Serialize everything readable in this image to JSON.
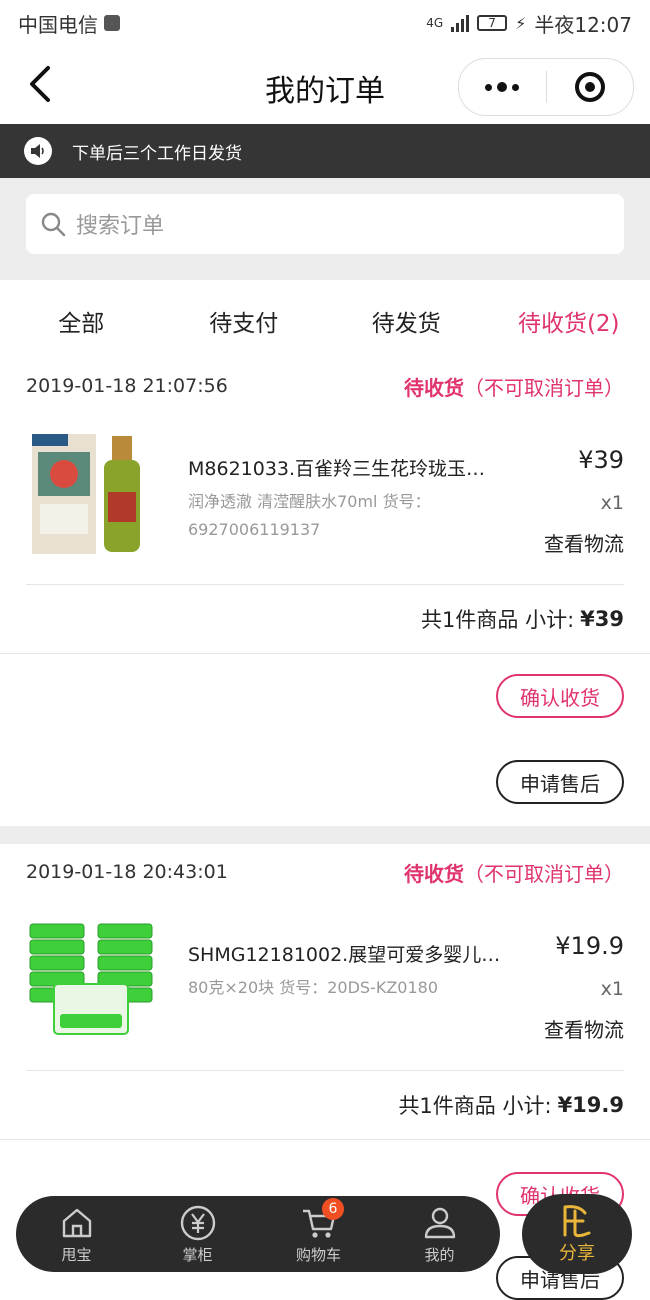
{
  "status_bar": {
    "carrier": "中国电信",
    "network": "4G",
    "battery": "7",
    "time": "半夜12:07"
  },
  "header": {
    "title": "我的订单"
  },
  "notice": {
    "text": "下单后三个工作日发货"
  },
  "search": {
    "placeholder": "搜索订单"
  },
  "tabs": [
    {
      "label": "全部",
      "active": false
    },
    {
      "label": "待支付",
      "active": false
    },
    {
      "label": "待发货",
      "active": false
    },
    {
      "label": "待收货(2)",
      "active": true
    }
  ],
  "orders": [
    {
      "time": "2019-01-18 21:07:56",
      "status": "待收货",
      "status_note": "（不可取消订单）",
      "item_title": "M8621033.百雀羚三生花玲珑玉…",
      "item_spec": "润净透澈   清滢醒肤水70ml   货号：6927006119137",
      "price": "¥39",
      "qty": "x1",
      "logistics": "查看物流",
      "subtotal_label": "共1件商品 小计:",
      "subtotal_value": "¥39",
      "confirm_btn": "确认收货",
      "after_sale_btn": "申请售后"
    },
    {
      "time": "2019-01-18 20:43:01",
      "status": "待收货",
      "status_note": "（不可取消订单）",
      "item_title": "SHMG12181002.展望可爱多婴儿…",
      "item_spec": "80克×20块   货号：20DS-KZ0180",
      "price": "¥19.9",
      "qty": "x1",
      "logistics": "查看物流",
      "subtotal_label": "共1件商品 小计:",
      "subtotal_value": "¥19.9",
      "confirm_btn": "确认收货",
      "after_sale_btn": "申请售后"
    }
  ],
  "bottom_nav": [
    {
      "label": "甩宝",
      "icon": "home-icon"
    },
    {
      "label": "掌柜",
      "icon": "yen-icon"
    },
    {
      "label": "购物车",
      "icon": "cart-icon",
      "badge": "6"
    },
    {
      "label": "我的",
      "icon": "user-icon"
    }
  ],
  "share": {
    "label": "分享"
  },
  "colors": {
    "accent": "#e0336f",
    "notice_bg": "#353535",
    "nav_bg": "#2b2b2b",
    "share_gold": "#e9b63a",
    "badge": "#f04e23"
  }
}
